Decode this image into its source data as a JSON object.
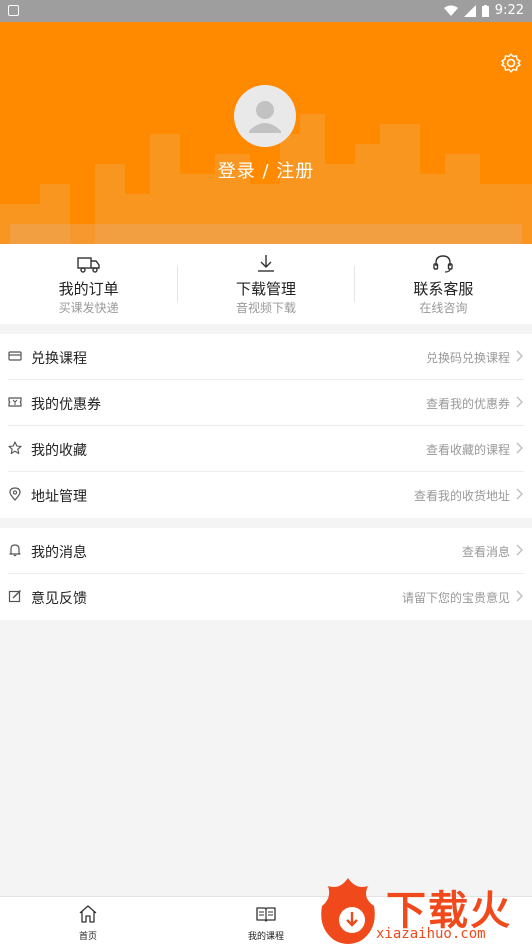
{
  "status_bar": {
    "time": "9:22"
  },
  "header": {
    "login_label": "登录 / 注册"
  },
  "quick_actions": [
    {
      "title": "我的订单",
      "sub": "买课发快递",
      "icon": "truck-icon"
    },
    {
      "title": "下载管理",
      "sub": "音视频下载",
      "icon": "download-icon"
    },
    {
      "title": "联系客服",
      "sub": "在线咨询",
      "icon": "headset-icon"
    }
  ],
  "menu_group_1": [
    {
      "label": "兑换课程",
      "value": "兑换码兑换课程",
      "icon": "card-icon"
    },
    {
      "label": "我的优惠券",
      "value": "查看我的优惠券",
      "icon": "coupon-icon"
    },
    {
      "label": "我的收藏",
      "value": "查看收藏的课程",
      "icon": "star-icon"
    },
    {
      "label": "地址管理",
      "value": "查看我的收货地址",
      "icon": "location-icon"
    }
  ],
  "menu_group_2": [
    {
      "label": "我的消息",
      "value": "查看消息",
      "icon": "bell-icon"
    },
    {
      "label": "意见反馈",
      "value": "请留下您的宝贵意见",
      "icon": "edit-icon"
    }
  ],
  "tabs": [
    {
      "label": "首页",
      "icon": "home-icon"
    },
    {
      "label": "我的课程",
      "icon": "book-icon"
    }
  ],
  "watermark": {
    "text": "下载火",
    "url": "xiazaihuo.com"
  },
  "colors": {
    "accent": "#ff8a00",
    "watermark": "#f04a1c"
  }
}
